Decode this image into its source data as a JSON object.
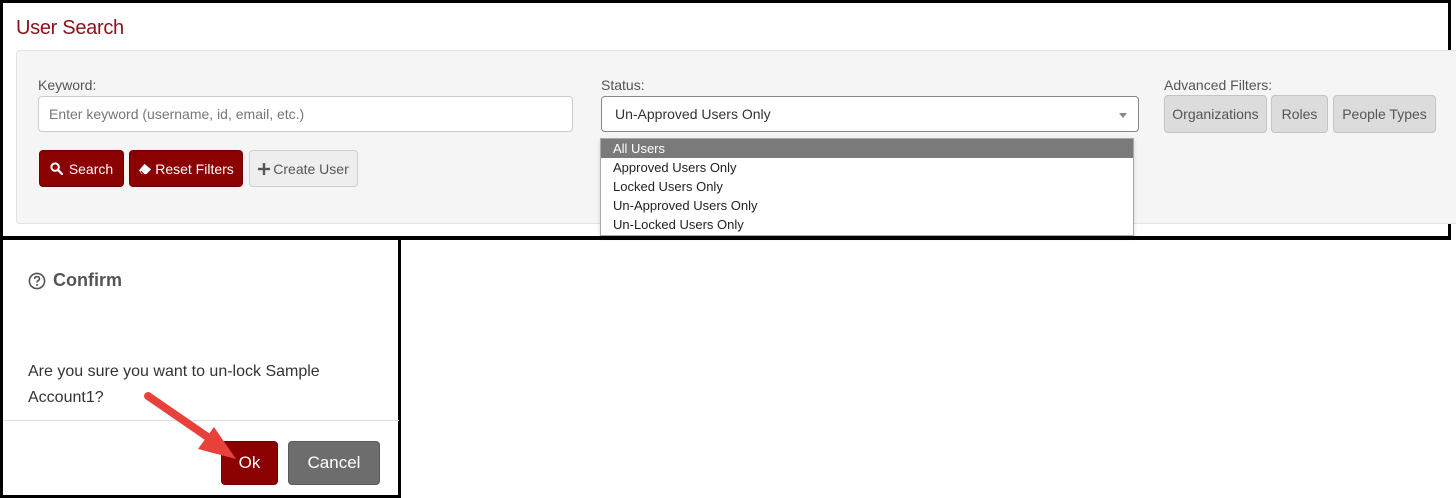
{
  "panel": {
    "title": "User Search"
  },
  "keyword": {
    "label": "Keyword:",
    "placeholder": "Enter keyword (username, id, email, etc.)",
    "value": ""
  },
  "status": {
    "label": "Status:",
    "selected": "Un-Approved Users Only",
    "options": [
      "All Users",
      "Approved Users Only",
      "Locked Users Only",
      "Un-Approved Users Only",
      "Un-Locked Users Only"
    ],
    "highlighted": "All Users"
  },
  "advanced": {
    "label": "Advanced Filters:",
    "buttons": [
      "Organizations",
      "Roles",
      "People Types"
    ]
  },
  "actions": {
    "search": "Search",
    "reset": "Reset Filters",
    "create": "Create User"
  },
  "dialog": {
    "title": "Confirm",
    "message": "Are you sure you want to un-lock Sample Account1?",
    "ok": "Ok",
    "cancel": "Cancel"
  },
  "colors": {
    "brand": "#8b1218",
    "primary_button": "#8b0000",
    "secondary_button": "#6d6d6d",
    "annotation_arrow": "#e8413b"
  },
  "icons": [
    "search-icon",
    "eraser-icon",
    "plus-icon",
    "question-circle-icon",
    "arrow-annotation"
  ]
}
